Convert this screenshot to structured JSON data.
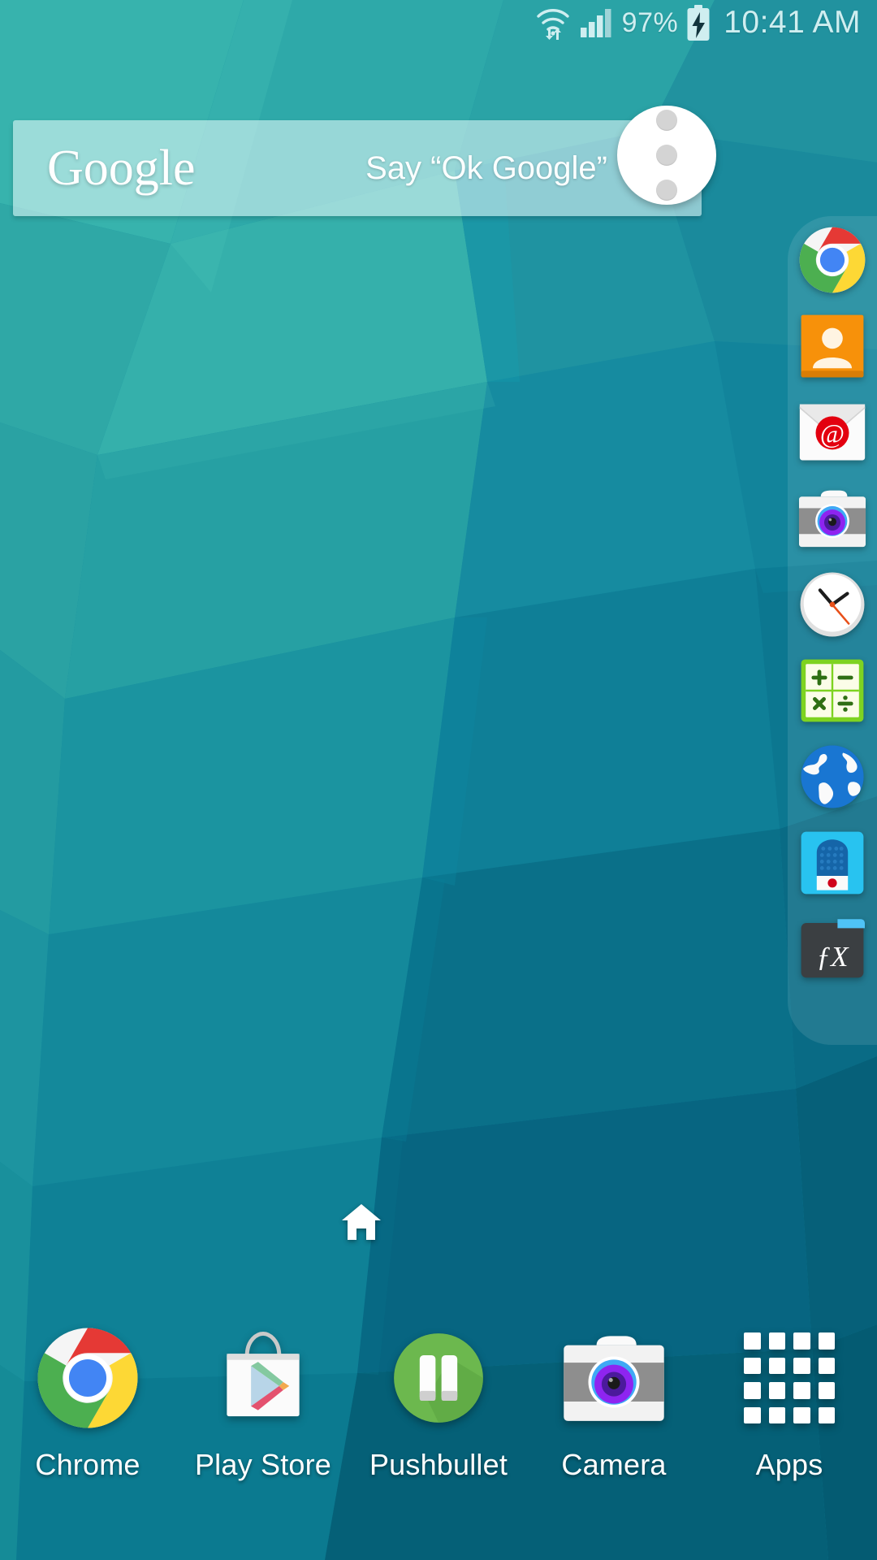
{
  "status_bar": {
    "wifi_icon": "wifi-transfer-icon",
    "signal_icon": "cellular-signal-icon",
    "battery_percent": "97%",
    "battery_icon": "battery-charging-icon",
    "clock": "10:41 AM"
  },
  "search_widget": {
    "logo_text": "Google",
    "voice_hint": "Say “Ok Google”",
    "overflow_icon": "overflow-menu-icon"
  },
  "sidebar": {
    "items": [
      {
        "name": "chrome",
        "icon": "chrome-icon"
      },
      {
        "name": "contacts",
        "icon": "contacts-icon"
      },
      {
        "name": "email",
        "icon": "email-icon"
      },
      {
        "name": "camera",
        "icon": "camera-icon"
      },
      {
        "name": "clock",
        "icon": "clock-icon"
      },
      {
        "name": "calculator",
        "icon": "calculator-icon"
      },
      {
        "name": "internet",
        "icon": "globe-browser-icon"
      },
      {
        "name": "voice-recorder",
        "icon": "voice-recorder-icon"
      },
      {
        "name": "fx-file-explorer",
        "icon": "fx-file-explorer-icon"
      }
    ]
  },
  "page_indicator": {
    "icon": "home-page-icon"
  },
  "dock": {
    "items": [
      {
        "label": "Chrome",
        "icon": "chrome-icon"
      },
      {
        "label": "Play Store",
        "icon": "play-store-icon"
      },
      {
        "label": "Pushbullet",
        "icon": "pushbullet-icon"
      },
      {
        "label": "Camera",
        "icon": "camera-icon"
      },
      {
        "label": "Apps",
        "icon": "apps-grid-icon"
      }
    ]
  },
  "colors": {
    "wallpaper_base": "#107a92",
    "wallpaper_light": "#39b7b0",
    "wallpaper_dark": "#0a5f78",
    "status_text": "#cfeef0",
    "label_text": "#ffffff",
    "widget_fill": "rgba(234,252,252,0.56)"
  }
}
